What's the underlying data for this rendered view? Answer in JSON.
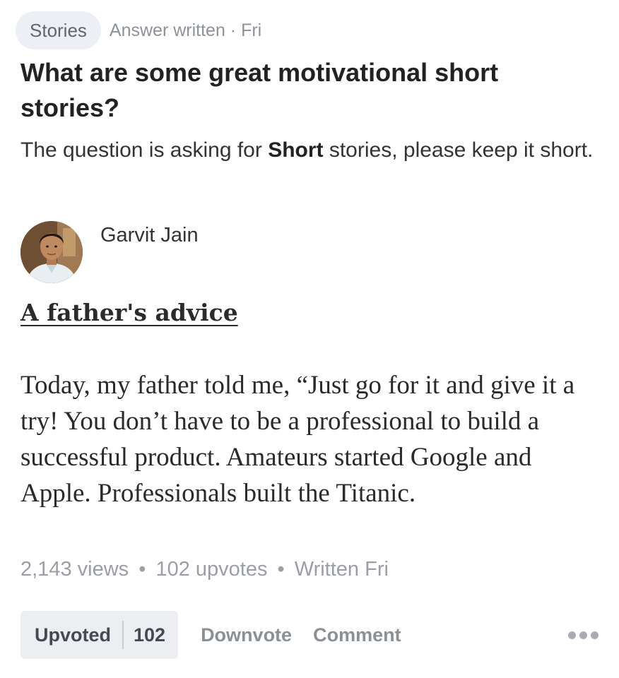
{
  "header": {
    "topic": "Stories",
    "answer_meta": "Answer written · Fri"
  },
  "question": {
    "title": "What are some great motivational short stories?",
    "details_before": "The question is asking for ",
    "details_bold": "Short",
    "details_after": " stories, please keep it short."
  },
  "author": {
    "name": "Garvit Jain",
    "avatar_icon": "user-photo"
  },
  "answer": {
    "title": "A father's advice",
    "body": "Today, my father told me, “Just go for it and give it a try! You don’t have to be a professional to build a successful product. Amateurs started Google and Apple. Professionals built the Titanic."
  },
  "stats": {
    "views": "2,143 views",
    "upvotes": "102 upvotes",
    "written": "Written Fri",
    "separator": "•"
  },
  "actions": {
    "upvoted_label": "Upvoted",
    "upvote_count": "102",
    "downvote_label": "Downvote",
    "comment_label": "Comment",
    "more_icon": "more-horizontal-dots"
  }
}
